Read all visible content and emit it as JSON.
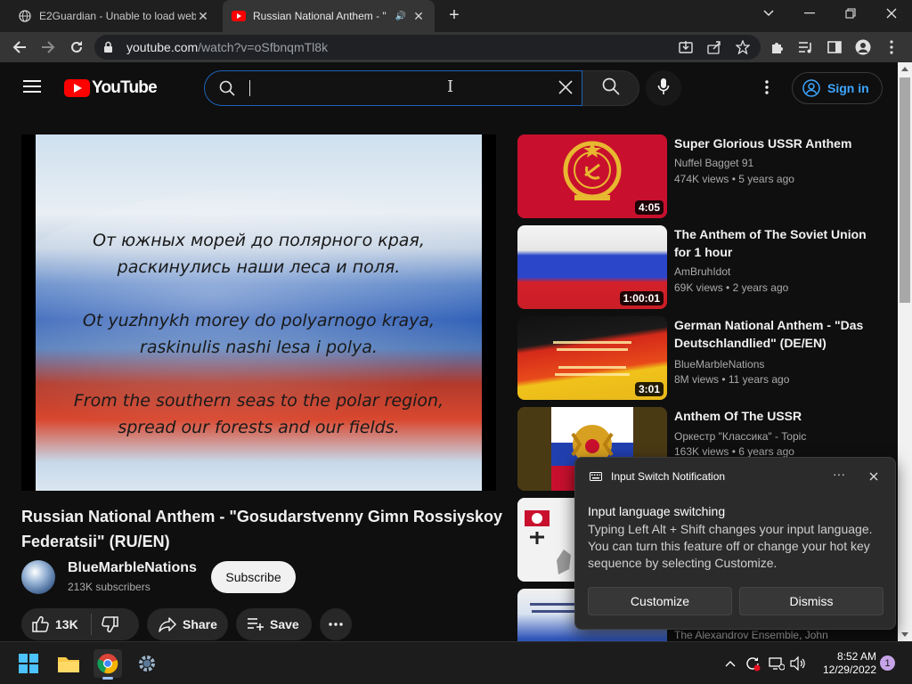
{
  "browser": {
    "tabs": [
      {
        "title": "E2Guardian - Unable to load web",
        "active": false
      },
      {
        "title": "Russian National Anthem - \"",
        "active": true
      }
    ],
    "url_host": "youtube.com",
    "url_path": "/watch?v=oSfbnqmTl8k"
  },
  "yt_header": {
    "logo_text": "YouTube",
    "search_value": "",
    "sign_in_label": "Sign in"
  },
  "video": {
    "lyrics": [
      "От южных морей до полярного края,",
      "раскинулись наши леса и поля.",
      "Ot yuzhnykh morey do polyarnogo kraya,",
      "raskinulis nashi lesa i polya.",
      "From the southern seas to the polar region,",
      "spread our forests and our fields."
    ],
    "title": "Russian National Anthem - \"Gosudarstvenny Gimn Rossiyskoy Federatsii\" (RU/EN)",
    "channel": "BlueMarbleNations",
    "subscribers": "213K subscribers",
    "subscribe_label": "Subscribe",
    "likes": "13K",
    "share_label": "Share",
    "save_label": "Save"
  },
  "recommendations": [
    {
      "title": "Super Glorious USSR Anthem",
      "channel": "Nuffel Bagget 91",
      "views": "474K views",
      "age": "5 years ago",
      "duration": "4:05"
    },
    {
      "title": "The Anthem of The Soviet Union for 1 hour",
      "channel": "AmBruhIdot",
      "views": "69K views",
      "age": "2 years ago",
      "duration": "1:00:01"
    },
    {
      "title": "German National Anthem - \"Das Deutschlandlied\" (DE/EN)",
      "channel": "BlueMarbleNations",
      "views": "8M views",
      "age": "11 years ago",
      "duration": "3:01"
    },
    {
      "title": "Anthem Of The USSR",
      "channel": "Оркестр \"Классика\" - Topic",
      "views": "163K views",
      "age": "6 years ago",
      "duration": ""
    },
    {
      "title": "",
      "channel": "",
      "views": "",
      "age": "",
      "duration": ""
    },
    {
      "title": "",
      "channel": "The Alexandrov Ensemble, John",
      "views": "",
      "age": "",
      "duration": ""
    }
  ],
  "notification": {
    "app": "Input Switch Notification",
    "heading": "Input language switching",
    "body": "Typing Left Alt + Shift changes your input language. You can turn this feature off or change your hot key sequence by selecting Customize.",
    "customize_label": "Customize",
    "dismiss_label": "Dismiss"
  },
  "taskbar": {
    "time": "8:52 AM",
    "date": "12/29/2022",
    "notification_count": "1"
  },
  "colors": {
    "yt_red": "#ff0000",
    "link_blue": "#3ea6ff",
    "search_focus": "#1c62b9",
    "background": "#0f0f0f"
  }
}
